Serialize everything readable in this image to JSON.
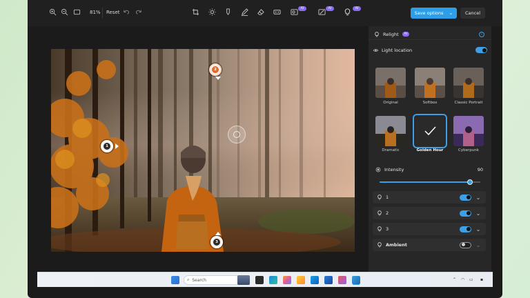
{
  "toolbar": {
    "zoom_level": "81%",
    "reset_label": "Reset",
    "save_label": "Save options",
    "cancel_label": "Cancel",
    "ai_badge": "AI",
    "icons": [
      "zoom-in-icon",
      "zoom-out-icon",
      "fit-screen-icon",
      "undo-icon",
      "redo-icon",
      "crop-icon",
      "adjust-icon",
      "markup-icon",
      "draw-icon",
      "erase-icon",
      "filter-icon",
      "background-icon",
      "restyle-icon",
      "relight-icon"
    ]
  },
  "canvas": {
    "pins": [
      {
        "label": "1",
        "color": "#2b2b2b"
      },
      {
        "label": "2",
        "color": "#e06a2c"
      },
      {
        "label": "3",
        "color": "#2b2b2b"
      }
    ]
  },
  "panel": {
    "title": "Relight",
    "ai_badge": "AI",
    "light_location_label": "Light location",
    "presets": [
      "Original",
      "Softbox",
      "Classic Portrait",
      "Dramatic",
      "Golden Hour",
      "Cyberpunk"
    ],
    "selected_preset": "Golden Hour",
    "intensity_label": "Intensity",
    "intensity_value": "90",
    "intensity_fraction": 0.9,
    "lights": [
      {
        "label": "1",
        "enabled": true
      },
      {
        "label": "2",
        "enabled": true
      },
      {
        "label": "3",
        "enabled": true
      },
      {
        "label": "Ambient",
        "enabled": false
      }
    ]
  },
  "taskbar": {
    "search_placeholder": "Search",
    "accent": "#3da0e6"
  }
}
